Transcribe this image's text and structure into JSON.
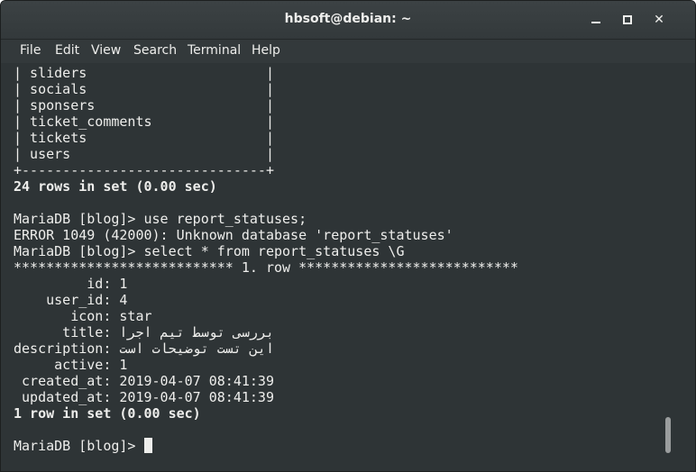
{
  "window": {
    "title": "hbsoft@debian: ~",
    "min_icon": "minimize-icon",
    "max_icon": "maximize-icon",
    "close_icon": "close-icon",
    "close_glyph": "✕"
  },
  "menu": [
    "File",
    "Edit",
    "View",
    "Search",
    "Terminal",
    "Help"
  ],
  "terminal": {
    "lines": [
      {
        "text": "| sliders                      |",
        "bold": false
      },
      {
        "text": "| socials                      |",
        "bold": false
      },
      {
        "text": "| sponsers                     |",
        "bold": false
      },
      {
        "text": "| ticket_comments              |",
        "bold": false
      },
      {
        "text": "| tickets                      |",
        "bold": false
      },
      {
        "text": "| users                        |",
        "bold": false
      },
      {
        "text": "+------------------------------+",
        "bold": false
      },
      {
        "text": "24 rows in set (0.00 sec)",
        "bold": true
      },
      {
        "text": "",
        "bold": false
      },
      {
        "text": "MariaDB [blog]> use report_statuses;",
        "bold": false
      },
      {
        "text": "ERROR 1049 (42000): Unknown database 'report_statuses'",
        "bold": false
      },
      {
        "text": "MariaDB [blog]> select * from report_statuses \\G",
        "bold": false
      },
      {
        "text": "*************************** 1. row ***************************",
        "bold": false
      },
      {
        "text": "         id: 1",
        "bold": false
      },
      {
        "text": "    user_id: 4",
        "bold": false
      },
      {
        "text": "       icon: star",
        "bold": false
      },
      {
        "text": "      title: بررسی توسط تیم اجرا",
        "bold": false
      },
      {
        "text": "description: این تست توضیحات است",
        "bold": false
      },
      {
        "text": "     active: 1",
        "bold": false
      },
      {
        "text": " created_at: 2019-04-07 08:41:39",
        "bold": false
      },
      {
        "text": " updated_at: 2019-04-07 08:41:39",
        "bold": false
      },
      {
        "text": "1 row in set (0.00 sec)",
        "bold": true
      },
      {
        "text": "",
        "bold": false
      }
    ],
    "prompt": "MariaDB [blog]> "
  }
}
